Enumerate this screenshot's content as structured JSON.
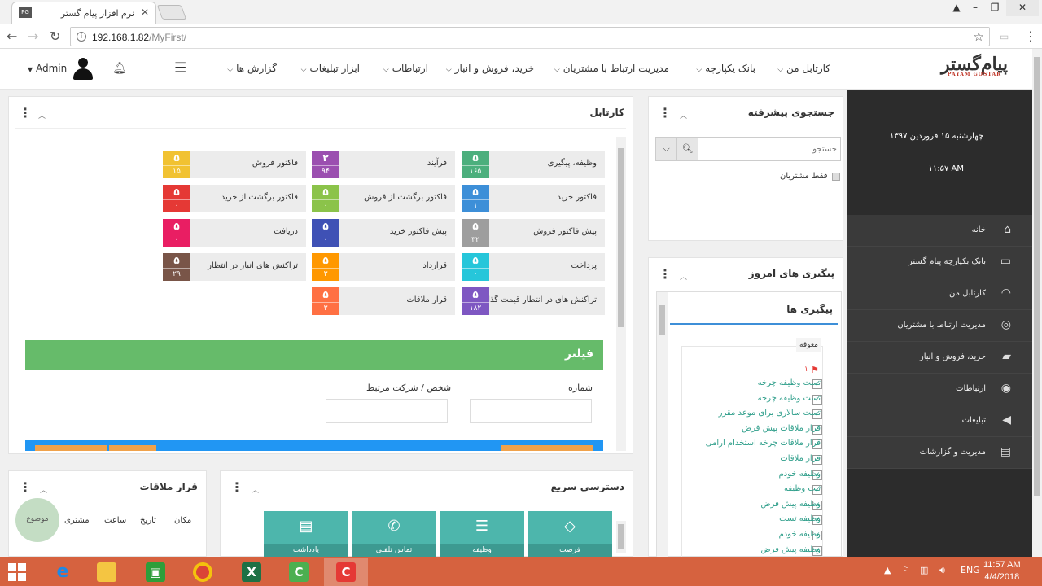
{
  "browser": {
    "tab_title": "نرم افزار پیام گستر",
    "favicon_text": "PG",
    "url_host": "192.168.1.82",
    "url_path": "/MyFirst/"
  },
  "header": {
    "logo_text": "پیام‌گستر",
    "logo_sub": "PAYAM GOSTAR",
    "menu": [
      "کارتابل من",
      "بانک یکپارچه",
      "مدیریت ارتباط با مشتریان",
      "خرید، فروش و انبار",
      "ارتباطات",
      "ابزار تبلیغات",
      "گزارش ها"
    ],
    "user_name": "Admin"
  },
  "sidebar": {
    "date": "چهارشنبه ۱۵ فروردین ۱۳۹۷",
    "time": "۱۱:۵۷ AM",
    "items": [
      {
        "label": "خانه",
        "icon": "home-icon"
      },
      {
        "label": "بانک یکپارچه پیام گستر",
        "icon": "printer-icon"
      },
      {
        "label": "کارتابل من",
        "icon": "dashboard-icon"
      },
      {
        "label": "مدیریت ارتباط با مشتریان",
        "icon": "lifebuoy-icon"
      },
      {
        "label": "خرید، فروش و انبار",
        "icon": "truck-icon"
      },
      {
        "label": "ارتباطات",
        "icon": "broadcast-icon"
      },
      {
        "label": "تبلیغات",
        "icon": "megaphone-icon"
      },
      {
        "label": "مدیریت و گزارشات",
        "icon": "report-icon"
      }
    ]
  },
  "kartabl": {
    "title": "کارتابل",
    "tiles": [
      {
        "label": "وظیفه، پیگیری",
        "n1": "۵",
        "n2": "۱۶۵",
        "color": "#4caf7d"
      },
      {
        "label": "فرآیند",
        "n1": "۲",
        "n2": "۹۴",
        "color": "#9b4fb0"
      },
      {
        "label": "فاکتور فروش",
        "n1": "۵",
        "n2": "۱۵",
        "color": "#f1c232"
      },
      {
        "label": "فاکتور خرید",
        "n1": "۵",
        "n2": "۱",
        "color": "#3d8fd8"
      },
      {
        "label": "فاکتور برگشت از فروش",
        "n1": "۵",
        "n2": "۰",
        "color": "#8bc34a"
      },
      {
        "label": "فاکتور برگشت از خرید",
        "n1": "۵",
        "n2": "۰",
        "color": "#e53935"
      },
      {
        "label": "پیش فاکتور فروش",
        "n1": "۵",
        "n2": "۳۲",
        "color": "#9e9e9e"
      },
      {
        "label": "پیش فاکتور خرید",
        "n1": "۵",
        "n2": "۰",
        "color": "#3f51b5"
      },
      {
        "label": "دریافت",
        "n1": "۵",
        "n2": "۰",
        "color": "#e91e63"
      },
      {
        "label": "پرداخت",
        "n1": "۵",
        "n2": "۰",
        "color": "#26c6da"
      },
      {
        "label": "قرارداد",
        "n1": "۵",
        "n2": "۳",
        "color": "#ff9800"
      },
      {
        "label": "تراکنش های انبار در انتظار",
        "n1": "۵",
        "n2": "۲۹",
        "color": "#795548"
      },
      {
        "label": "تراکنش های در انتظار قیمت گذاری",
        "n1": "۵",
        "n2": "۱۸۲",
        "color": "#7e57c2"
      },
      {
        "label": "قرار ملاقات",
        "n1": "۵",
        "n2": "۳",
        "color": "#ff7043"
      }
    ],
    "filter_title": "فیلتر",
    "field_number": "شماره",
    "field_person": "شخص / شرکت مرتبط"
  },
  "search_panel": {
    "title": "جستجوی پیشرفته",
    "placeholder": "جستجو",
    "only_customers": "فقط مشتریان"
  },
  "followups": {
    "title": "پیگیری های امروز",
    "subtitle": "پیگیری ها",
    "group": "معوقه",
    "count": "۱",
    "items": [
      "تست وظیفه چرخه",
      "تست وظیفه چرخه",
      "تست سالاری برای موعد مقرر",
      "قرار ملاقات پیش فرض",
      "قرار ملاقات چرخه استخدام ارامی",
      "قرار ملاقات",
      "وظیفه خودم",
      "ثبت وظیفه",
      "وظیفه پیش فرض",
      "وظیفه تست",
      "وظیفه خودم",
      "وظیفه پیش فرض"
    ]
  },
  "quick_access": {
    "title": "دسترسی سریع",
    "items": [
      {
        "label": "فرصت",
        "icon": "diamond-icon"
      },
      {
        "label": "وظیفه",
        "icon": "server-icon"
      },
      {
        "label": "تماس تلفنی",
        "icon": "phone-icon"
      },
      {
        "label": "یادداشت",
        "icon": "note-icon"
      }
    ]
  },
  "meetings": {
    "title": "قرار ملاقات",
    "columns": [
      "مکان",
      "تاریخ",
      "ساعت",
      "مشتری",
      "موضوع"
    ]
  },
  "taskbar": {
    "lang": "ENG",
    "time": "11:57 AM",
    "date": "4/4/2018"
  }
}
